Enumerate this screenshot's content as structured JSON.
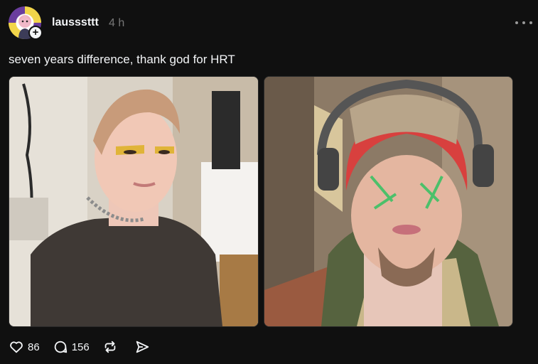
{
  "post": {
    "username": "lausssttt",
    "timestamp": "4 h",
    "caption": "seven years difference, thank god for HRT",
    "follow_symbol": "+",
    "images": [
      {
        "icon": "photo-before"
      },
      {
        "icon": "photo-after"
      }
    ]
  },
  "actions": {
    "likes": "86",
    "replies": "156"
  },
  "icons": {
    "more": "more-icon",
    "like": "heart-icon",
    "reply": "comment-icon",
    "repost": "repost-icon",
    "share": "share-icon"
  },
  "colors": {
    "background": "#101010",
    "text": "#f3f5f7",
    "muted": "#777777"
  }
}
